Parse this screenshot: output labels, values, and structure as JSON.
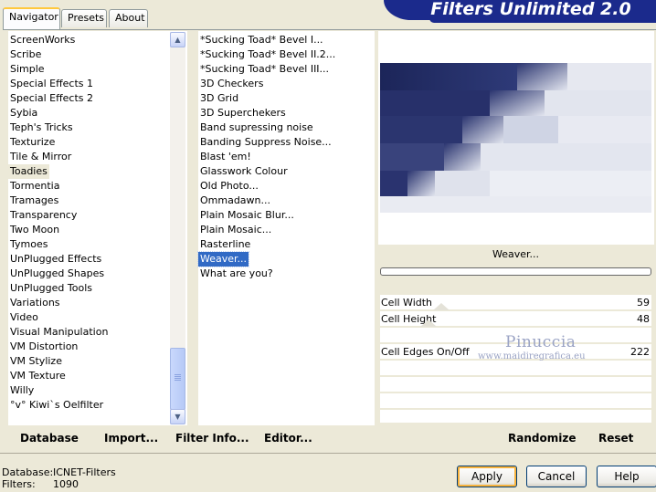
{
  "tabs": [
    "Navigator",
    "Presets",
    "About"
  ],
  "app_title": "Filters Unlimited 2.0",
  "categories": [
    "ScreenWorks",
    "Scribe",
    "Simple",
    "Special Effects 1",
    "Special Effects 2",
    "Sybia",
    "Teph's Tricks",
    "Texturize",
    "Tile & Mirror",
    "Toadies",
    "Tormentia",
    "Tramages",
    "Transparency",
    "Two Moon",
    "Tymoes",
    "UnPlugged Effects",
    "UnPlugged Shapes",
    "UnPlugged Tools",
    "Variations",
    "Video",
    "Visual Manipulation",
    "VM Distortion",
    "VM Stylize",
    "VM Texture",
    "Willy",
    "°v° Kiwi`s Oelfilter"
  ],
  "filters": [
    "*Sucking Toad*  Bevel I...",
    "*Sucking Toad*  Bevel II.2...",
    "*Sucking Toad*  Bevel III...",
    "3D Checkers",
    "3D Grid",
    "3D Superchekers",
    "Band supressing noise",
    "Banding Suppress Noise...",
    "Blast 'em!",
    "Glasswork Colour",
    "Old Photo...",
    "Ommadawn...",
    "Plain Mosaic Blur...",
    "Plain Mosaic...",
    "Rasterline",
    "Weaver...",
    "What are you?"
  ],
  "selected_filter_name": "Weaver...",
  "params": {
    "cell_width": {
      "label": "Cell Width",
      "value": "59"
    },
    "cell_height": {
      "label": "Cell Height",
      "value": "48"
    },
    "cell_edges": {
      "label": "Cell Edges On/Off",
      "value": "222"
    }
  },
  "watermark": {
    "name": "Pinuccia",
    "site": "www.maidiregrafica.eu"
  },
  "bottom": {
    "database": "Database",
    "import": "Import...",
    "filter_info": "Filter Info...",
    "editor": "Editor...",
    "randomize": "Randomize",
    "reset": "Reset"
  },
  "status": {
    "database_label": "Database:",
    "database_value": "ICNET-Filters",
    "filters_label": "Filters:",
    "filters_value": "1090"
  },
  "buttons": {
    "apply": "Apply",
    "cancel": "Cancel",
    "help": "Help"
  }
}
